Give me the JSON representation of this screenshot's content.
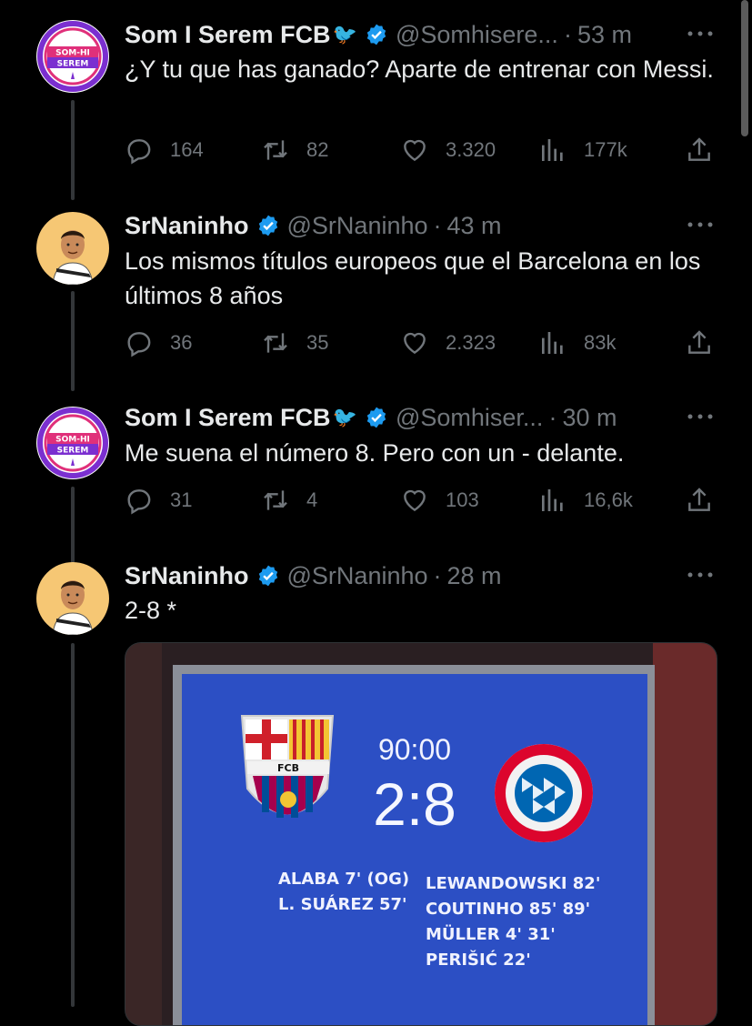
{
  "tweets": [
    {
      "name": "Som I Serem FCB",
      "handle": "@Somhisere...",
      "time": "53 m",
      "text": "¿Y tu que has ganado? Aparte de entrenar con Messi.",
      "avatar_text": [
        "SOM-HI",
        "SEREM"
      ],
      "replies": "164",
      "retweets": "82",
      "likes": "3.320",
      "views": "177k"
    },
    {
      "name": "SrNaninho",
      "handle": "@SrNaninho",
      "time": "43 m",
      "text": "Los mismos títulos europeos que el Barcelona en los últimos 8 años",
      "replies": "36",
      "retweets": "35",
      "likes": "2.323",
      "views": "83k"
    },
    {
      "name": "Som I Serem FCB",
      "handle": "@Somhiser...",
      "time": "30 m",
      "text": "Me suena el número 8. Pero con un - delante.",
      "avatar_text": [
        "SOM-HI",
        "SEREM"
      ],
      "replies": "31",
      "retweets": "4",
      "likes": "103",
      "views": "16,6k"
    },
    {
      "name": "SrNaninho",
      "handle": "@SrNaninho",
      "time": "28 m",
      "text": "2-8 *"
    }
  ],
  "scoreboard": {
    "clock": "90:00",
    "score": "2:8",
    "home_crest": "FCB",
    "home_scorers": [
      "ALABA 7' (OG)",
      "L. SUÁREZ 57'"
    ],
    "away_scorers": [
      "LEWANDOWSKI 82'",
      "COUTINHO 85' 89'",
      "MÜLLER 4' 31'",
      "PERIŠIĆ 22'"
    ]
  },
  "colors": {
    "background": "#000000",
    "text": "#e7e9ea",
    "muted": "#71767b",
    "verified": "#1d9bf0",
    "scoreboard": "#2c4fc4"
  }
}
